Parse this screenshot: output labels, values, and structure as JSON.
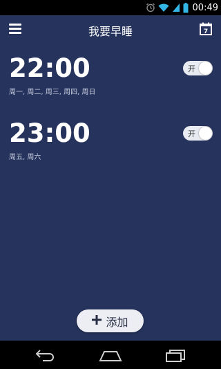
{
  "status_bar": {
    "time": "00:49"
  },
  "header": {
    "title": "我要早睡"
  },
  "calendar": {
    "day": "7"
  },
  "alarms": [
    {
      "time": "22:00",
      "days": "周一, 周二, 周三, 周四, 周日",
      "toggle_label": "开"
    },
    {
      "time": "23:00",
      "days": "周五, 周六",
      "toggle_label": "开"
    }
  ],
  "add_button": {
    "label": "添加"
  },
  "colors": {
    "background": "#26335c",
    "toggle": "#e9ebf2"
  },
  "icons": [
    "alarm-clock-icon",
    "wifi-icon",
    "signal-icon",
    "battery-icon",
    "menu-icon",
    "calendar-icon",
    "plus-icon",
    "back-icon",
    "home-icon",
    "recent-apps-icon"
  ]
}
